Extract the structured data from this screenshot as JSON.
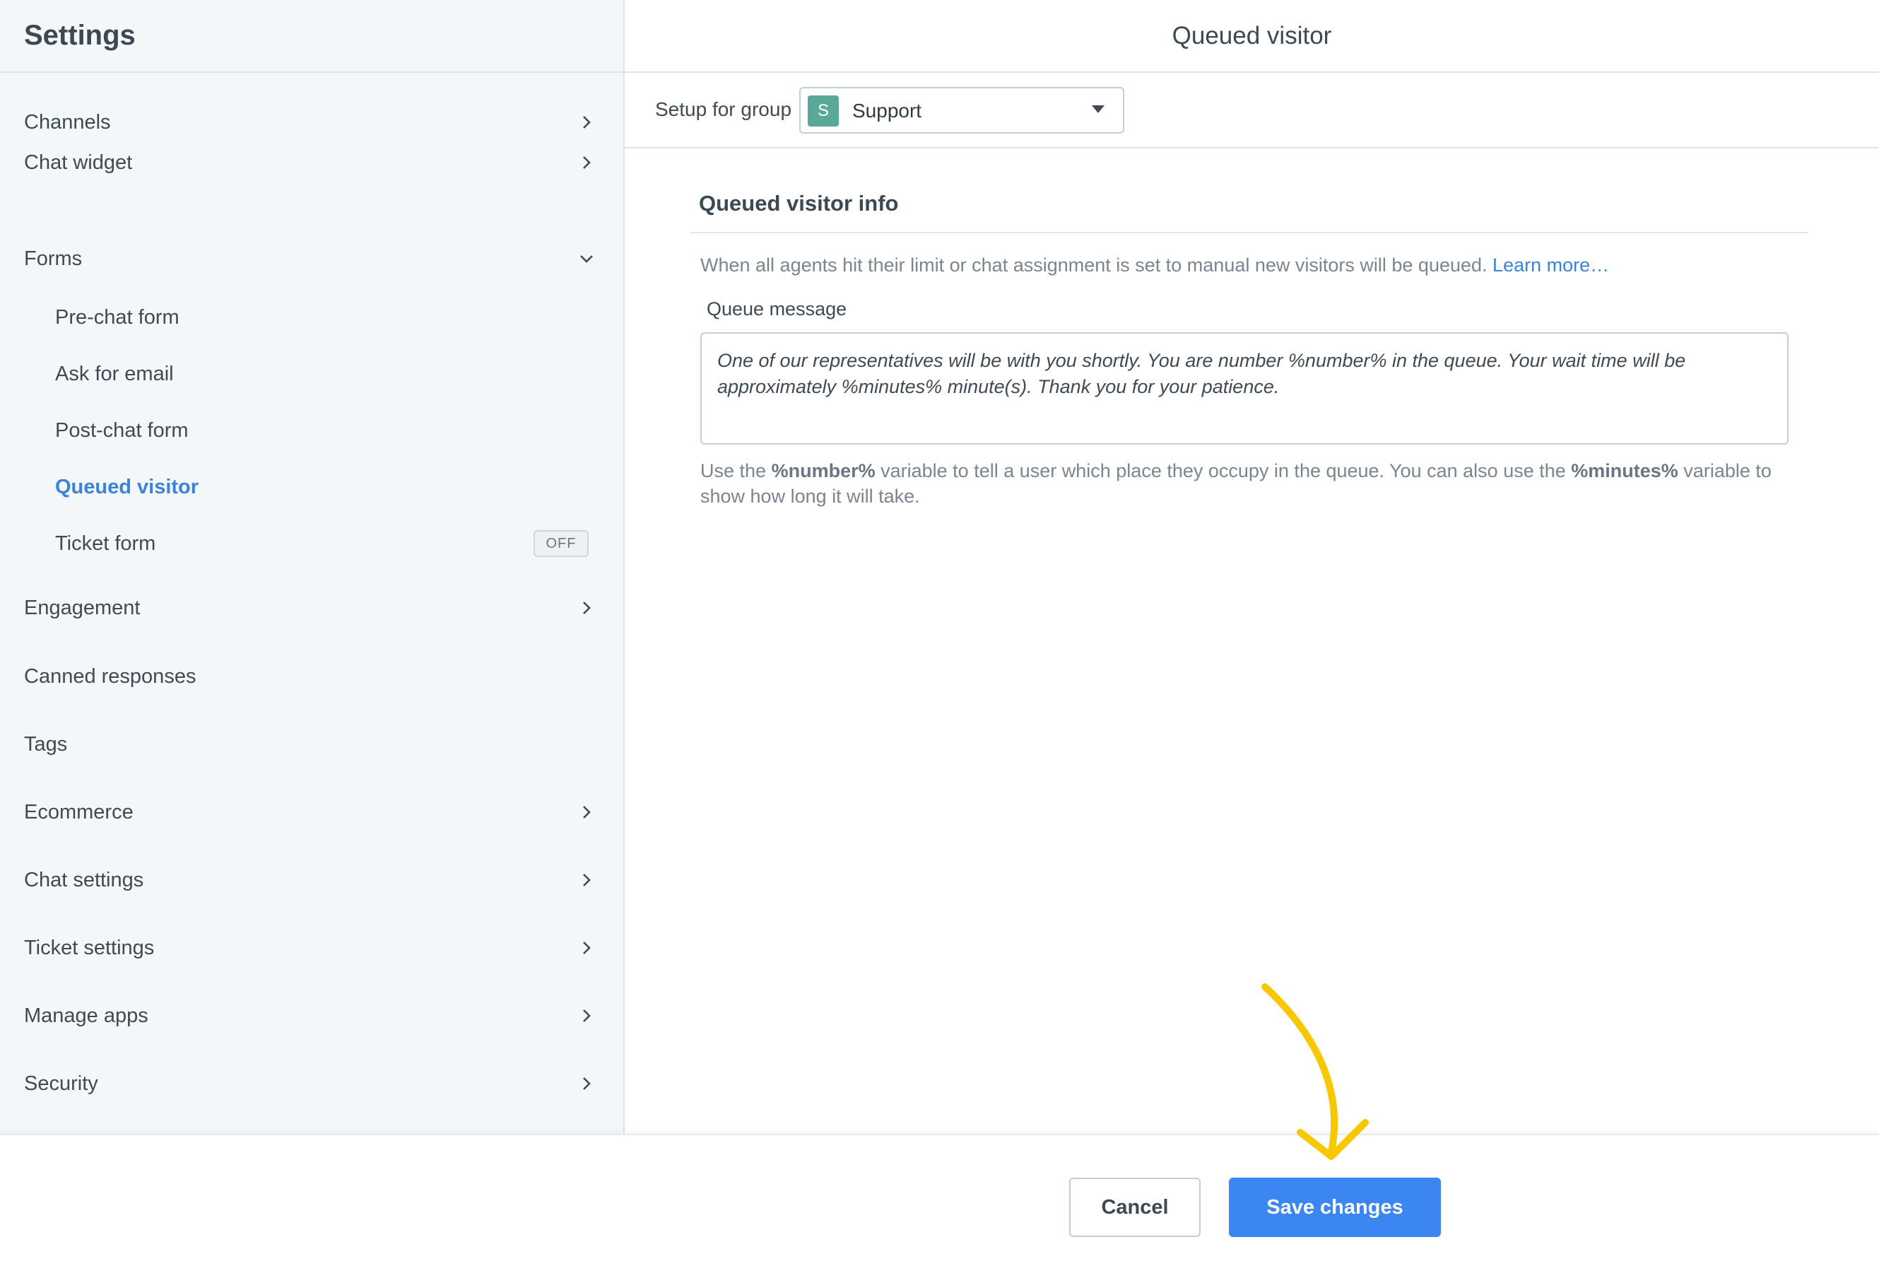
{
  "sidebar": {
    "title": "Settings",
    "items": [
      {
        "label": "Channels",
        "chevron": "right"
      },
      {
        "label": "Chat widget",
        "chevron": "right"
      },
      {
        "label": "Forms",
        "chevron": "down"
      },
      {
        "label": "Pre-chat form"
      },
      {
        "label": "Ask for email"
      },
      {
        "label": "Post-chat form"
      },
      {
        "label": "Queued visitor",
        "active": true
      },
      {
        "label": "Ticket form",
        "badge": "OFF"
      },
      {
        "label": "Engagement",
        "chevron": "right"
      },
      {
        "label": "Canned responses"
      },
      {
        "label": "Tags"
      },
      {
        "label": "Ecommerce",
        "chevron": "right"
      },
      {
        "label": "Chat settings",
        "chevron": "right"
      },
      {
        "label": "Ticket settings",
        "chevron": "right"
      },
      {
        "label": "Manage apps",
        "chevron": "right"
      },
      {
        "label": "Security",
        "chevron": "right"
      }
    ]
  },
  "main": {
    "title": "Queued visitor",
    "group": {
      "label": "Setup for group",
      "avatar_letter": "S",
      "selected": "Support"
    },
    "section": {
      "title": "Queued visitor info",
      "info": "When all agents hit their limit or chat assignment is set to manual new visitors will be queued.",
      "learn_more": "Learn more…",
      "queue_label": "Queue message",
      "queue_message": "One of our representatives will be with you shortly. You are number %number% in the queue. Your wait time will be approximately %minutes% minute(s). Thank you for your patience.",
      "help_1": "Use the",
      "help_var_1": "%number%",
      "help_2": "variable to tell a user which place they occupy in the queue. You can also use the",
      "help_var_2": "%minutes%",
      "help_3": "variable to show how long it will take."
    }
  },
  "footer": {
    "cancel_label": "Cancel",
    "save_label": "Save changes"
  },
  "colors": {
    "accent": "#3b82d9",
    "save_button": "#3b86f0",
    "annotation_arrow": "#f7c800",
    "group_avatar": "#5aa89a"
  },
  "icons": {
    "chevron_right": "chevron-right-icon",
    "chevron_down": "chevron-down-icon",
    "dropdown": "caret-down-icon",
    "annotation": "arrow-annotation-icon"
  }
}
